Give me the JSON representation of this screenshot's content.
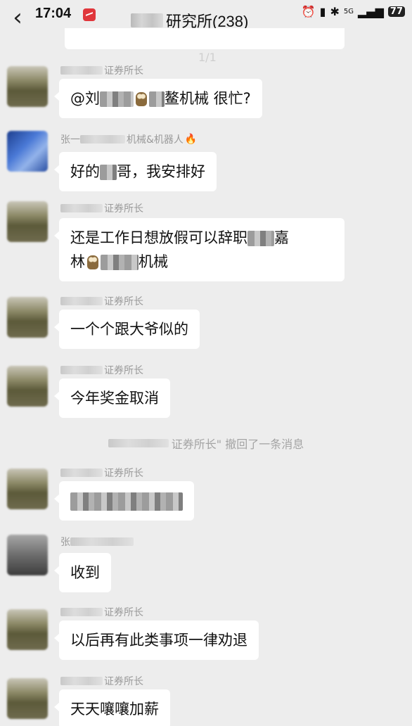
{
  "status_bar": {
    "time": "17:04",
    "network": "5G",
    "battery": "77"
  },
  "header": {
    "title": "研究所(238)",
    "page_indicator": "1/1"
  },
  "messages": [
    {
      "sender": "证券所长",
      "text_a": "@刘",
      "text_b": "鳌机械 很忙?",
      "avatar": "green"
    },
    {
      "sender": "张一",
      "sender_b": "机械&机器人",
      "text_a": "好的",
      "text_b": "哥，我安排好",
      "avatar": "blue"
    },
    {
      "sender": "证券所长",
      "text_a": "还是工作日想放假可以辞职",
      "text_b": "嘉",
      "text_c": "林",
      "text_d": "机械",
      "avatar": "green"
    },
    {
      "sender": "证券所长",
      "text": "一个个跟大爷似的",
      "avatar": "green"
    },
    {
      "sender": "证券所长",
      "text": "今年奖金取消",
      "avatar": "green"
    },
    {
      "system": "证券所长\" 撤回了一条消息"
    },
    {
      "sender": "证券所长",
      "text": "",
      "avatar": "green"
    },
    {
      "sender": "张",
      "text": "收到",
      "avatar": "gray"
    },
    {
      "sender": "证券所长",
      "text": "以后再有此类事项一律劝退",
      "avatar": "green"
    },
    {
      "sender": "证券所长",
      "text": "天天嚷嚷加薪",
      "avatar": "green"
    }
  ]
}
